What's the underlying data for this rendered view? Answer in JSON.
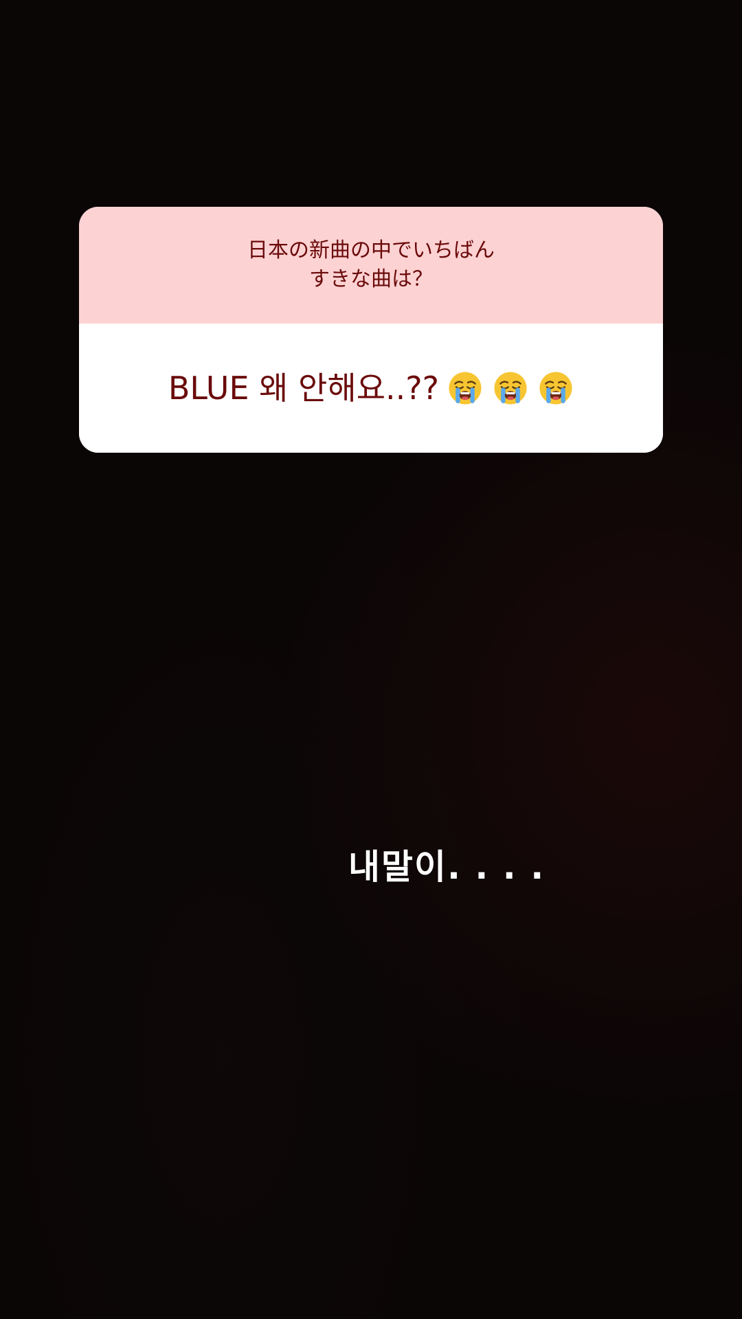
{
  "question_card": {
    "question": "日本の新曲の中でいちばん\nすきな曲は？",
    "answer": "BLUE 왜 안해요..??",
    "answer_emojis": [
      "loudly-crying-face-icon",
      "loudly-crying-face-icon",
      "loudly-crying-face-icon"
    ],
    "colors": {
      "question_bg": "#fdd2d3",
      "answer_bg": "#ffffff",
      "text": "#6a0a0a"
    }
  },
  "overlay_text": "내말이. . . .",
  "colors": {
    "background": "#0a0606",
    "overlay_text": "#ffffff"
  }
}
